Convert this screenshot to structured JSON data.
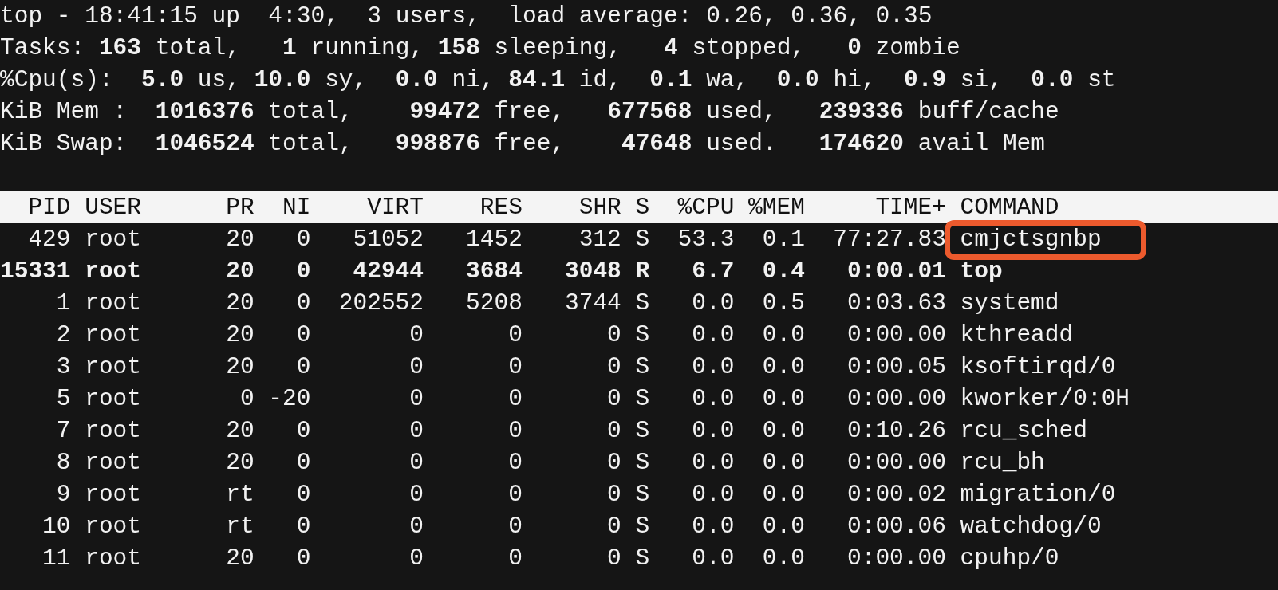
{
  "summary": [
    "top - 18:41:15 up  4:30,  3 users,  load average: 0.26, 0.36, 0.35",
    "Tasks: **163** total,   **1** running, **158** sleeping,   **4** stopped,   **0** zombie",
    "%Cpu(s):  **5.0** us, **10.0** sy,  **0.0** ni, **84.1** id,  **0.1** wa,  **0.0** hi,  **0.9** si,  **0.0** st",
    "KiB Mem :  **1016376** total,    **99472** free,   **677568** used,   **239336** buff/cache",
    "KiB Swap:  **1046524** total,   **998876** free,    **47648** used.   **174620** avail Mem"
  ],
  "columns": [
    "PID",
    "USER",
    "PR",
    "NI",
    "VIRT",
    "RES",
    "SHR",
    "S",
    "%CPU",
    "%MEM",
    "TIME+",
    "COMMAND"
  ],
  "rows": [
    {
      "cells": [
        "429",
        "root",
        "20",
        "0",
        "51052",
        "1452",
        "312",
        "S",
        "53.3",
        "0.1",
        "77:27.83",
        "cmjctsgnbp"
      ],
      "bold": false,
      "annotated": true
    },
    {
      "cells": [
        "15331",
        "root",
        "20",
        "0",
        "42944",
        "3684",
        "3048",
        "R",
        "6.7",
        "0.4",
        "0:00.01",
        "top"
      ],
      "bold": true,
      "annotated": false
    },
    {
      "cells": [
        "1",
        "root",
        "20",
        "0",
        "202552",
        "5208",
        "3744",
        "S",
        "0.0",
        "0.5",
        "0:03.63",
        "systemd"
      ],
      "bold": false,
      "annotated": false
    },
    {
      "cells": [
        "2",
        "root",
        "20",
        "0",
        "0",
        "0",
        "0",
        "S",
        "0.0",
        "0.0",
        "0:00.00",
        "kthreadd"
      ],
      "bold": false,
      "annotated": false
    },
    {
      "cells": [
        "3",
        "root",
        "20",
        "0",
        "0",
        "0",
        "0",
        "S",
        "0.0",
        "0.0",
        "0:00.05",
        "ksoftirqd/0"
      ],
      "bold": false,
      "annotated": false
    },
    {
      "cells": [
        "5",
        "root",
        "0",
        "-20",
        "0",
        "0",
        "0",
        "S",
        "0.0",
        "0.0",
        "0:00.00",
        "kworker/0:0H"
      ],
      "bold": false,
      "annotated": false
    },
    {
      "cells": [
        "7",
        "root",
        "20",
        "0",
        "0",
        "0",
        "0",
        "S",
        "0.0",
        "0.0",
        "0:10.26",
        "rcu_sched"
      ],
      "bold": false,
      "annotated": false
    },
    {
      "cells": [
        "8",
        "root",
        "20",
        "0",
        "0",
        "0",
        "0",
        "S",
        "0.0",
        "0.0",
        "0:00.00",
        "rcu_bh"
      ],
      "bold": false,
      "annotated": false
    },
    {
      "cells": [
        "9",
        "root",
        "rt",
        "0",
        "0",
        "0",
        "0",
        "S",
        "0.0",
        "0.0",
        "0:00.02",
        "migration/0"
      ],
      "bold": false,
      "annotated": false
    },
    {
      "cells": [
        "10",
        "root",
        "rt",
        "0",
        "0",
        "0",
        "0",
        "S",
        "0.0",
        "0.0",
        "0:00.06",
        "watchdog/0"
      ],
      "bold": false,
      "annotated": false
    },
    {
      "cells": [
        "11",
        "root",
        "20",
        "0",
        "0",
        "0",
        "0",
        "S",
        "0.0",
        "0.0",
        "0:00.00",
        "cpuhp/0"
      ],
      "bold": false,
      "annotated": false
    }
  ]
}
